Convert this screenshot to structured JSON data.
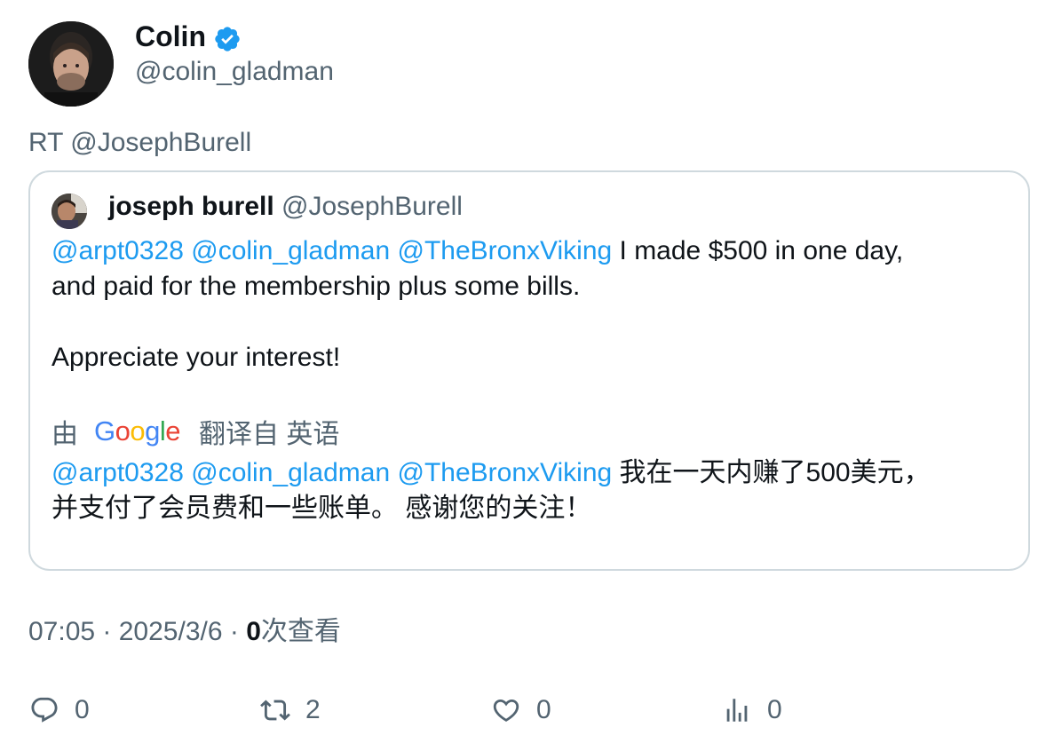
{
  "author": {
    "name": "Colin",
    "handle": "@colin_gladman",
    "verified": true
  },
  "retweet_prefix": "RT @JosephBurell",
  "quoted": {
    "name": "joseph burell",
    "handle": "@JosephBurell",
    "original": {
      "mentions": [
        "@arpt0328",
        "@colin_gladman",
        "@TheBronxViking"
      ],
      "line1_text": " I made $500 in one day,",
      "line2_text": "and paid for the membership plus some bills.",
      "line3_text": "Appreciate your interest!"
    },
    "translation_bar": {
      "by_label": "由",
      "provider": "Google",
      "from_label": "翻译自 英语"
    },
    "translated": {
      "mentions": [
        "@arpt0328",
        "@colin_gladman",
        "@TheBronxViking"
      ],
      "line1_text": " 我在一天内赚了500美元，",
      "line2_text": "并支付了会员费和一些账单。 感谢您的关注！"
    }
  },
  "meta": {
    "time": "07:05",
    "separator": " · ",
    "date": "2025/3/6",
    "views_count": "0",
    "views_label": "次查看"
  },
  "actions": {
    "reply": {
      "icon": "reply-icon",
      "count": "0"
    },
    "retweet": {
      "icon": "retweet-icon",
      "count": "2"
    },
    "like": {
      "icon": "heart-icon",
      "count": "0"
    },
    "views": {
      "icon": "analytics-icon",
      "count": "0"
    }
  },
  "colors": {
    "link": "#1d9bf0",
    "secondary": "#536471",
    "primary": "#0f1419",
    "border": "#cfd9de"
  }
}
